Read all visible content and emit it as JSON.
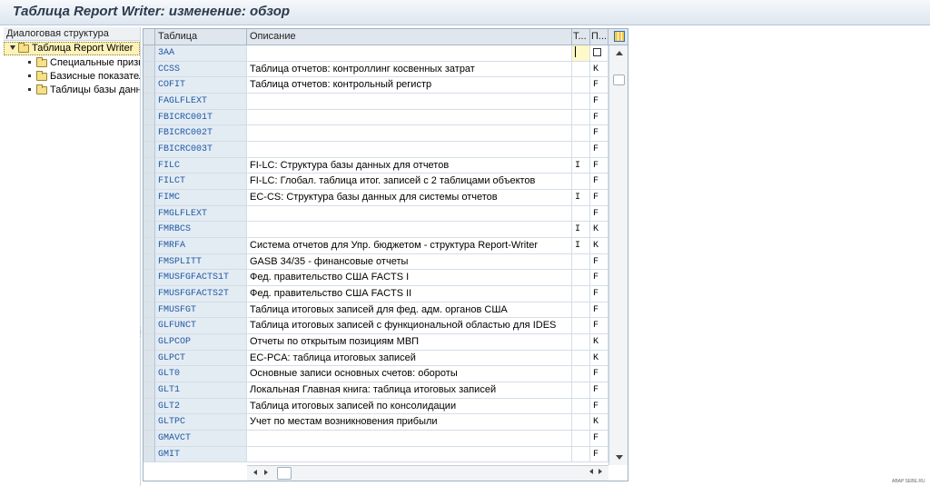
{
  "window": {
    "title": "Таблица Report Writer: изменение: обзор"
  },
  "tree": {
    "header": "Диалоговая структура",
    "root": {
      "label": "Таблица Report Writer",
      "icon": "folder-open-icon"
    },
    "children": [
      {
        "label": "Специальные призн",
        "icon": "folder-icon"
      },
      {
        "label": "Базисные показател",
        "icon": "folder-icon"
      },
      {
        "label": "Таблицы базы данн",
        "icon": "folder-icon"
      }
    ]
  },
  "table": {
    "columns": [
      "Таблица",
      "Описание",
      "Т...",
      "П..."
    ],
    "rows": [
      {
        "table": "3AA",
        "desc": "",
        "t": "",
        "p": ""
      },
      {
        "table": "CCSS",
        "desc": "Таблица отчетов: контроллинг косвенных затрат",
        "t": "",
        "p": "K"
      },
      {
        "table": "COFIT",
        "desc": "Таблица отчетов: контрольный регистр",
        "t": "",
        "p": "F"
      },
      {
        "table": "FAGLFLEXT",
        "desc": "",
        "t": "",
        "p": "F"
      },
      {
        "table": "FBICRC001T",
        "desc": "",
        "t": "",
        "p": "F"
      },
      {
        "table": "FBICRC002T",
        "desc": "",
        "t": "",
        "p": "F"
      },
      {
        "table": "FBICRC003T",
        "desc": "",
        "t": "",
        "p": "F"
      },
      {
        "table": "FILC",
        "desc": "FI-LC: Структура базы данных для отчетов",
        "t": "I",
        "p": "F"
      },
      {
        "table": "FILCT",
        "desc": "FI-LC: Глобал. таблица итог. записей с 2 таблицами объектов",
        "t": "",
        "p": "F"
      },
      {
        "table": "FIMC",
        "desc": "EC-CS: Структура базы данных для системы отчетов",
        "t": "I",
        "p": "F"
      },
      {
        "table": "FMGLFLEXT",
        "desc": "",
        "t": "",
        "p": "F"
      },
      {
        "table": "FMRBCS",
        "desc": "",
        "t": "I",
        "p": "K"
      },
      {
        "table": "FMRFA",
        "desc": "Система отчетов для Упр. бюджетом - структура Report-Writer",
        "t": "I",
        "p": "K"
      },
      {
        "table": "FMSPLITT",
        "desc": "GASB 34/35 - финансовые отчеты",
        "t": "",
        "p": "F"
      },
      {
        "table": "FMUSFGFACTS1T",
        "desc": "Фед. правительство США FACTS I",
        "t": "",
        "p": "F"
      },
      {
        "table": "FMUSFGFACTS2T",
        "desc": "Фед. правительство США FACTS II",
        "t": "",
        "p": "F"
      },
      {
        "table": "FMUSFGT",
        "desc": "Таблица итоговых записей для фед. адм. органов США",
        "t": "",
        "p": "F"
      },
      {
        "table": "GLFUNCT",
        "desc": "Таблица итоговых записей с функциональной областью для IDES",
        "t": "",
        "p": "F"
      },
      {
        "table": "GLPCOP",
        "desc": "Отчеты по открытым позициям МВП",
        "t": "",
        "p": "K"
      },
      {
        "table": "GLPCT",
        "desc": "EC-PCA: таблица итоговых записей",
        "t": "",
        "p": "K"
      },
      {
        "table": "GLT0",
        "desc": "Основные записи основных счетов: обороты",
        "t": "",
        "p": "F"
      },
      {
        "table": "GLT1",
        "desc": "Локальная Главная книга: таблица итоговых записей",
        "t": "",
        "p": "F"
      },
      {
        "table": "GLT2",
        "desc": "Таблица итоговых записей по консолидации",
        "t": "",
        "p": "F"
      },
      {
        "table": "GLTPC",
        "desc": "Учет по местам возникновения прибыли",
        "t": "",
        "p": "K"
      },
      {
        "table": "GMAVCT",
        "desc": "",
        "t": "",
        "p": "F"
      },
      {
        "table": "GMIT",
        "desc": "",
        "t": "",
        "p": "F"
      }
    ]
  },
  "footer": {
    "watermark": "ABAP SEBE.RU"
  },
  "colors": {
    "accent": "#1f58a3",
    "header_bg": "#dfe6ee",
    "selected_bg": "#fdf2b8"
  }
}
